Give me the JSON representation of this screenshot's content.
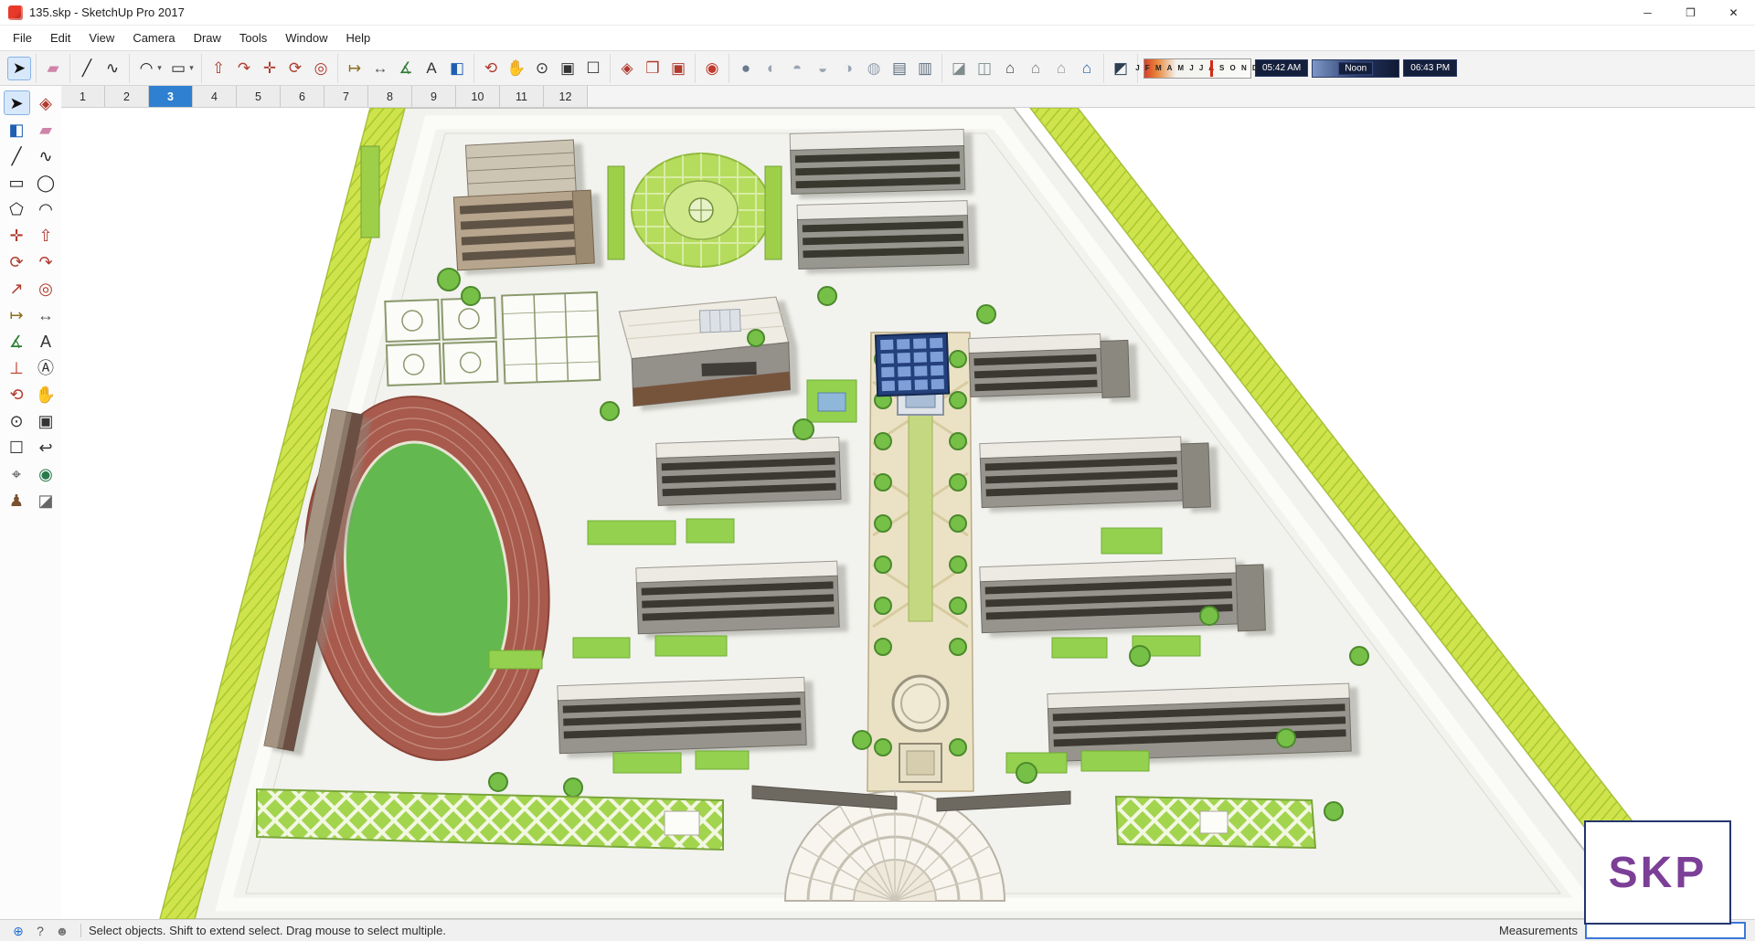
{
  "window": {
    "title": "135.skp - SketchUp Pro 2017",
    "controls": [
      {
        "name": "minimize",
        "glyph": "─",
        "color": "#333"
      },
      {
        "name": "maximize",
        "glyph": "❒",
        "color": "#333"
      },
      {
        "name": "close",
        "glyph": "✕",
        "color": "#222"
      }
    ]
  },
  "menu": {
    "items": [
      "File",
      "Edit",
      "View",
      "Camera",
      "Draw",
      "Tools",
      "Window",
      "Help"
    ]
  },
  "main_toolbar": {
    "groups": [
      {
        "icons": [
          {
            "name": "select",
            "glyph": "➤",
            "color": "#111",
            "active": true
          }
        ]
      },
      {
        "icons": [
          {
            "name": "eraser",
            "glyph": "▰",
            "color": "#d083a8"
          }
        ]
      },
      {
        "icons": [
          {
            "name": "line",
            "glyph": "╱",
            "color": "#222"
          },
          {
            "name": "freehand",
            "glyph": "∿",
            "color": "#222"
          }
        ]
      },
      {
        "icons": [
          {
            "name": "arc",
            "glyph": "◠",
            "color": "#222"
          },
          {
            "name": "arc-menu-caret",
            "glyph": "▾",
            "color": "#555",
            "caret": true
          },
          {
            "name": "shapes",
            "glyph": "▭",
            "color": "#222"
          },
          {
            "name": "shapes-menu-caret",
            "glyph": "▾",
            "color": "#555",
            "caret": true
          }
        ]
      },
      {
        "icons": [
          {
            "name": "push-pull",
            "glyph": "⇧",
            "color": "#b03a2e"
          },
          {
            "name": "follow-me",
            "glyph": "↷",
            "color": "#b03a2e"
          },
          {
            "name": "move",
            "glyph": "✛",
            "color": "#b03a2e"
          },
          {
            "name": "rotate",
            "glyph": "⟳",
            "color": "#b03a2e"
          },
          {
            "name": "offset",
            "glyph": "◎",
            "color": "#b03a2e"
          }
        ]
      },
      {
        "icons": [
          {
            "name": "tape-measure",
            "glyph": "↦",
            "color": "#8a6d1f"
          },
          {
            "name": "dimension",
            "glyph": "↔",
            "color": "#555"
          },
          {
            "name": "protractor",
            "glyph": "∡",
            "color": "#2e7d32"
          },
          {
            "name": "text",
            "glyph": "A",
            "color": "#333"
          },
          {
            "name": "paint-bucket",
            "glyph": "◧",
            "color": "#1f5fb0"
          }
        ]
      },
      {
        "icons": [
          {
            "name": "orbit",
            "glyph": "⟲",
            "color": "#b03a2e"
          },
          {
            "name": "pan",
            "glyph": "✋",
            "color": "#c9a227"
          },
          {
            "name": "zoom",
            "glyph": "⊙",
            "color": "#333"
          },
          {
            "name": "zoom-window",
            "glyph": "▣",
            "color": "#333"
          },
          {
            "name": "zoom-extents",
            "glyph": "☐",
            "color": "#333"
          }
        ]
      },
      {
        "icons": [
          {
            "name": "make-component",
            "glyph": "◈",
            "color": "#b03a2e"
          },
          {
            "name": "component-edit",
            "glyph": "❒",
            "color": "#b03a2e"
          },
          {
            "name": "component-options",
            "glyph": "▣",
            "color": "#b03a2e"
          }
        ]
      },
      {
        "icons": [
          {
            "name": "geo-location",
            "glyph": "◉",
            "color": "#c0392b"
          }
        ]
      },
      {
        "icons": [
          {
            "name": "solid-outer-shell",
            "glyph": "●",
            "color": "#6b7a8c"
          },
          {
            "name": "solid-intersect",
            "glyph": "◐",
            "color": "#9aa6b3"
          },
          {
            "name": "solid-union",
            "glyph": "◓",
            "color": "#9aa6b3"
          },
          {
            "name": "solid-subtract",
            "glyph": "◒",
            "color": "#9aa6b3"
          },
          {
            "name": "solid-trim",
            "glyph": "◑",
            "color": "#9aa6b3"
          },
          {
            "name": "solid-split",
            "glyph": "◍",
            "color": "#9aa6b3"
          },
          {
            "name": "soften-edges",
            "glyph": "▤",
            "color": "#5d6d7e"
          },
          {
            "name": "sandbox",
            "glyph": "▥",
            "color": "#5d6d7e"
          }
        ]
      },
      {
        "icons": [
          {
            "name": "section-plane",
            "glyph": "◪",
            "color": "#7f8c8d"
          },
          {
            "name": "section-fill",
            "glyph": "◫",
            "color": "#7f8c8d"
          },
          {
            "name": "get-models",
            "glyph": "⌂",
            "color": "#444"
          },
          {
            "name": "share-model",
            "glyph": "⌂",
            "color": "#777"
          },
          {
            "name": "share-component",
            "glyph": "⌂",
            "color": "#999"
          },
          {
            "name": "extension-warehouse",
            "glyph": "⌂",
            "color": "#1f5fb0"
          }
        ]
      },
      {
        "icons": [
          {
            "name": "shadows-toggle",
            "glyph": "◩",
            "color": "#2c3e50"
          }
        ]
      }
    ]
  },
  "toolbar_shadow": {
    "months": "J F M A M J J A S O N D",
    "time_start": "05:42 AM",
    "time_mid": "Noon",
    "time_end": "06:43 PM"
  },
  "scene_tabs": {
    "tabs": [
      "1",
      "2",
      "3",
      "4",
      "5",
      "6",
      "7",
      "8",
      "9",
      "10",
      "11",
      "12"
    ],
    "active": "3"
  },
  "palette": {
    "tools": [
      {
        "name": "select",
        "glyph": "➤",
        "color": "#111",
        "active": true
      },
      {
        "name": "make-component",
        "glyph": "◈",
        "color": "#b03a2e"
      },
      {
        "name": "paint-bucket",
        "glyph": "◧",
        "color": "#1f5fb0"
      },
      {
        "name": "eraser",
        "glyph": "▰",
        "color": "#d083a8"
      },
      {
        "name": "line",
        "glyph": "╱",
        "color": "#222"
      },
      {
        "name": "freehand",
        "glyph": "∿",
        "color": "#222"
      },
      {
        "name": "rectangle",
        "glyph": "▭",
        "color": "#222"
      },
      {
        "name": "circle",
        "glyph": "◯",
        "color": "#222"
      },
      {
        "name": "polygon",
        "glyph": "⬠",
        "color": "#222"
      },
      {
        "name": "arc",
        "glyph": "◠",
        "color": "#222"
      },
      {
        "name": "move",
        "glyph": "✛",
        "color": "#b03a2e"
      },
      {
        "name": "push-pull",
        "glyph": "⇧",
        "color": "#b03a2e"
      },
      {
        "name": "rotate",
        "glyph": "⟳",
        "color": "#b03a2e"
      },
      {
        "name": "follow-me",
        "glyph": "↷",
        "color": "#b03a2e"
      },
      {
        "name": "scale",
        "glyph": "↗",
        "color": "#b03a2e"
      },
      {
        "name": "offset",
        "glyph": "◎",
        "color": "#b03a2e"
      },
      {
        "name": "tape-measure",
        "glyph": "↦",
        "color": "#8a6d1f"
      },
      {
        "name": "dimension",
        "glyph": "↔",
        "color": "#555"
      },
      {
        "name": "protractor",
        "glyph": "∡",
        "color": "#2e7d32"
      },
      {
        "name": "text",
        "glyph": "A",
        "color": "#333"
      },
      {
        "name": "axes",
        "glyph": "⊥",
        "color": "#c0392b"
      },
      {
        "name": "3d-text",
        "glyph": "Ⓐ",
        "color": "#333"
      },
      {
        "name": "orbit",
        "glyph": "⟲",
        "color": "#b03a2e"
      },
      {
        "name": "pan",
        "glyph": "✋",
        "color": "#c9a227"
      },
      {
        "name": "zoom",
        "glyph": "⊙",
        "color": "#333"
      },
      {
        "name": "zoom-window",
        "glyph": "▣",
        "color": "#333"
      },
      {
        "name": "zoom-extents",
        "glyph": "☐",
        "color": "#333"
      },
      {
        "name": "previous-view",
        "glyph": "↩",
        "color": "#333"
      },
      {
        "name": "position-camera",
        "glyph": "⌖",
        "color": "#555"
      },
      {
        "name": "look-around",
        "glyph": "◉",
        "color": "#2a7a4b"
      },
      {
        "name": "walk",
        "glyph": "♟",
        "color": "#7a5230"
      },
      {
        "name": "section-plane",
        "glyph": "◪",
        "color": "#666"
      }
    ]
  },
  "statusbar": {
    "icons": [
      {
        "name": "geolocation-status",
        "glyph": "⊕",
        "color": "#1f6fd0"
      },
      {
        "name": "help-status",
        "glyph": "?",
        "color": "#555"
      },
      {
        "name": "credits-status",
        "glyph": "☻",
        "color": "#777"
      }
    ],
    "hint": "Select objects. Shift to extend select. Drag mouse to select multiple.",
    "measurements_label": "Measurements",
    "measurements_value": ""
  },
  "watermark": {
    "text": "SKP"
  },
  "colors": {
    "active_tab": "#2f80d0",
    "watermark_text": "#7c3f98",
    "median_green": "#cfe44c",
    "track_red": "#a85a4c",
    "field_green": "#63b94f"
  }
}
